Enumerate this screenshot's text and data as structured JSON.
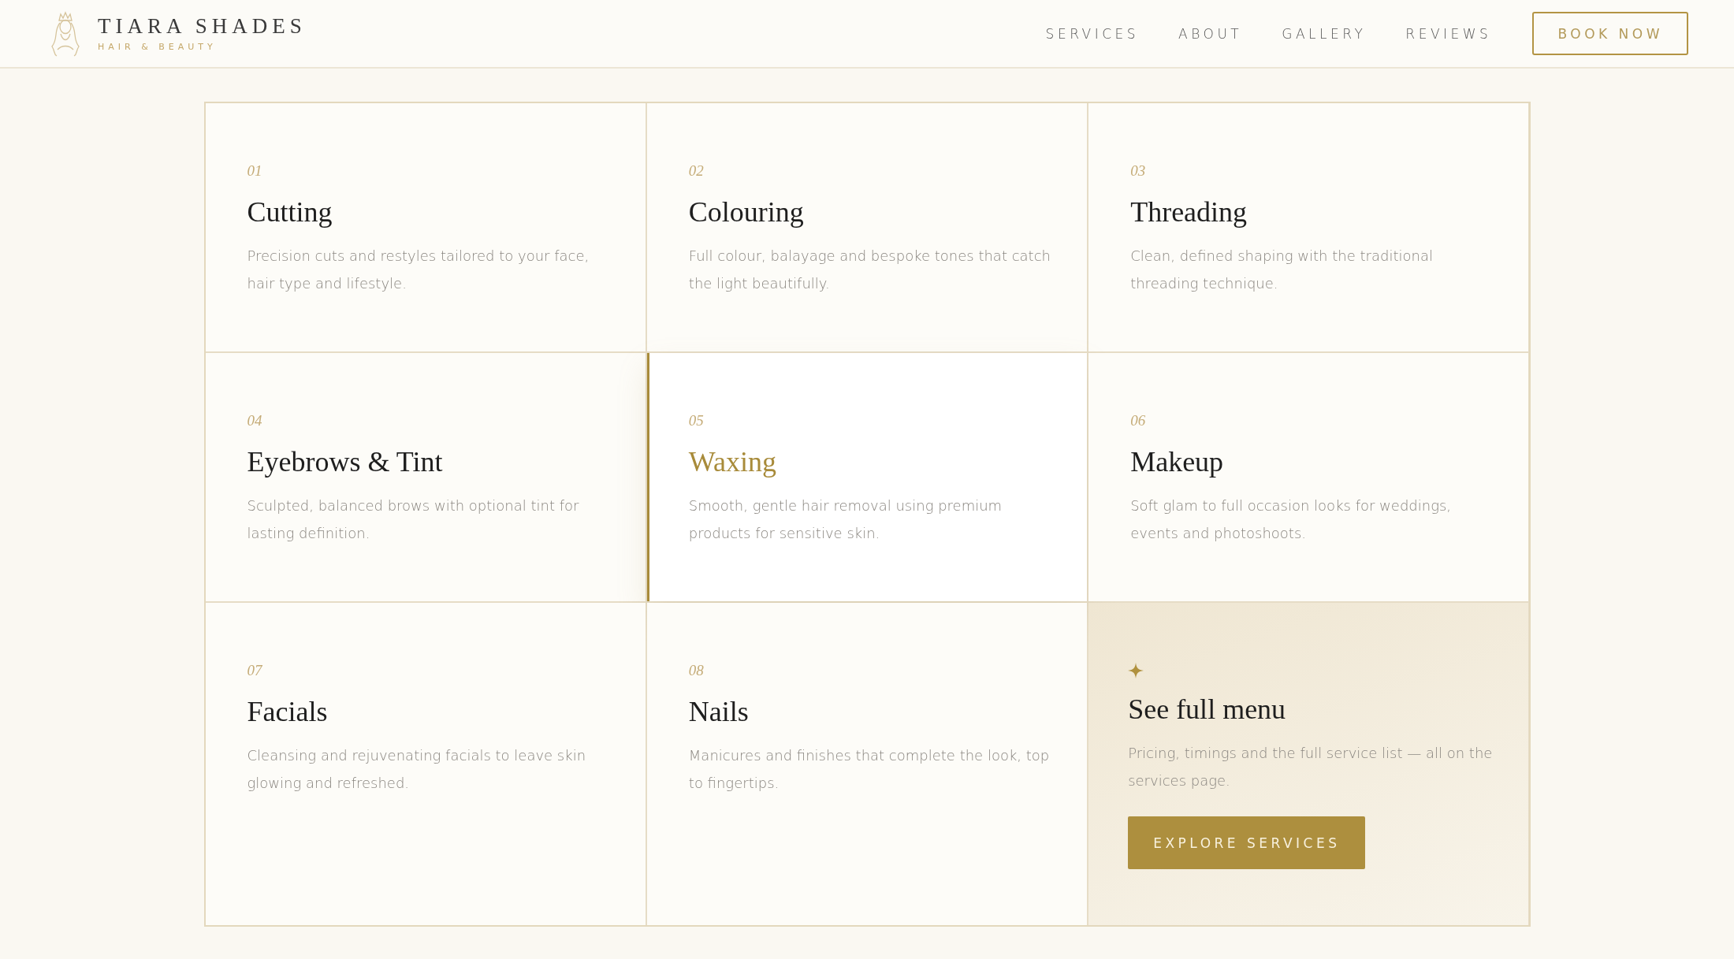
{
  "brand": {
    "name": "TIARA SHADES",
    "tagline": "HAIR & BEAUTY"
  },
  "nav": {
    "links": [
      "SERVICES",
      "ABOUT",
      "GALLERY",
      "REVIEWS"
    ],
    "cta": "BOOK NOW"
  },
  "services": [
    {
      "number": "01",
      "title": "Cutting",
      "description": "Precision cuts and restyles tailored to your face, hair type and lifestyle.",
      "selected": false
    },
    {
      "number": "02",
      "title": "Colouring",
      "description": "Full colour, balayage and bespoke tones that catch the light beautifully.",
      "selected": false
    },
    {
      "number": "03",
      "title": "Threading",
      "description": "Clean, defined shaping with the traditional threading technique.",
      "selected": false
    },
    {
      "number": "04",
      "title": "Eyebrows & Tint",
      "description": "Sculpted, balanced brows with optional tint for lasting definition.",
      "selected": false
    },
    {
      "number": "05",
      "title": "Waxing",
      "description": "Smooth, gentle hair removal using premium products for sensitive skin.",
      "selected": true
    },
    {
      "number": "06",
      "title": "Makeup",
      "description": "Soft glam to full occasion looks for weddings, events and photoshoots.",
      "selected": false
    },
    {
      "number": "07",
      "title": "Facials",
      "description": "Cleansing and rejuvenating facials to leave skin glowing and refreshed.",
      "selected": false
    },
    {
      "number": "08",
      "title": "Nails",
      "description": "Manicures and finishes that complete the look, top to fingertips.",
      "selected": false
    }
  ],
  "menu_card": {
    "title": "See full menu",
    "description": "Pricing, timings and the full service list — all on the services page.",
    "button": "EXPLORE SERVICES"
  }
}
